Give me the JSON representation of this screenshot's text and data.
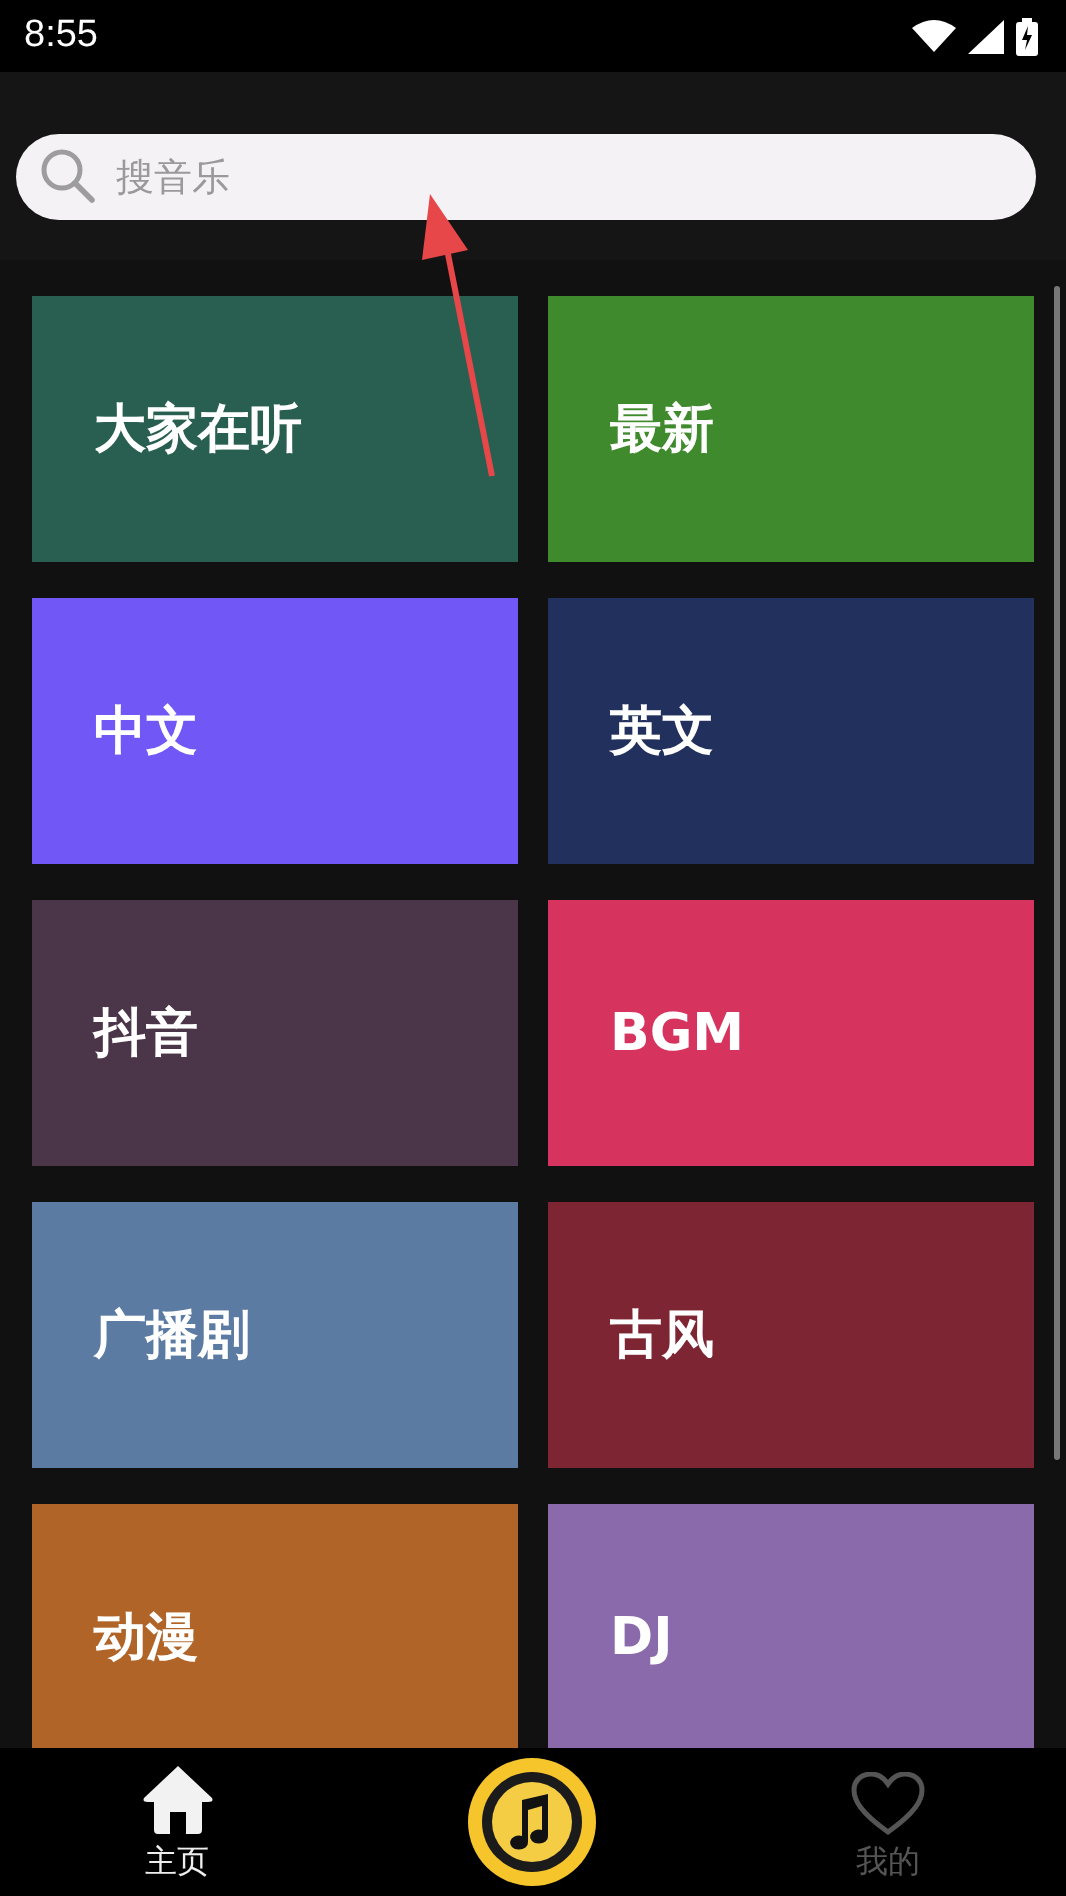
{
  "status_bar": {
    "time": "8:55"
  },
  "search": {
    "placeholder": "搜音乐"
  },
  "categories": [
    {
      "label": "大家在听",
      "color": "#285f51"
    },
    {
      "label": "最新",
      "color": "#3f8a2d"
    },
    {
      "label": "中文",
      "color": "#7057f6"
    },
    {
      "label": "英文",
      "color": "#22305e"
    },
    {
      "label": "抖音",
      "color": "#4a3549"
    },
    {
      "label": "BGM",
      "color": "#d6335e"
    },
    {
      "label": "广播剧",
      "color": "#5b7ba3"
    },
    {
      "label": "古风",
      "color": "#7e2534"
    },
    {
      "label": "动漫",
      "color": "#b06427"
    },
    {
      "label": "DJ",
      "color": "#8b6aab"
    }
  ],
  "nav": [
    {
      "label": "主页",
      "kind": "home",
      "selected": true
    },
    {
      "label": "我的",
      "kind": "heart",
      "selected": false
    }
  ]
}
